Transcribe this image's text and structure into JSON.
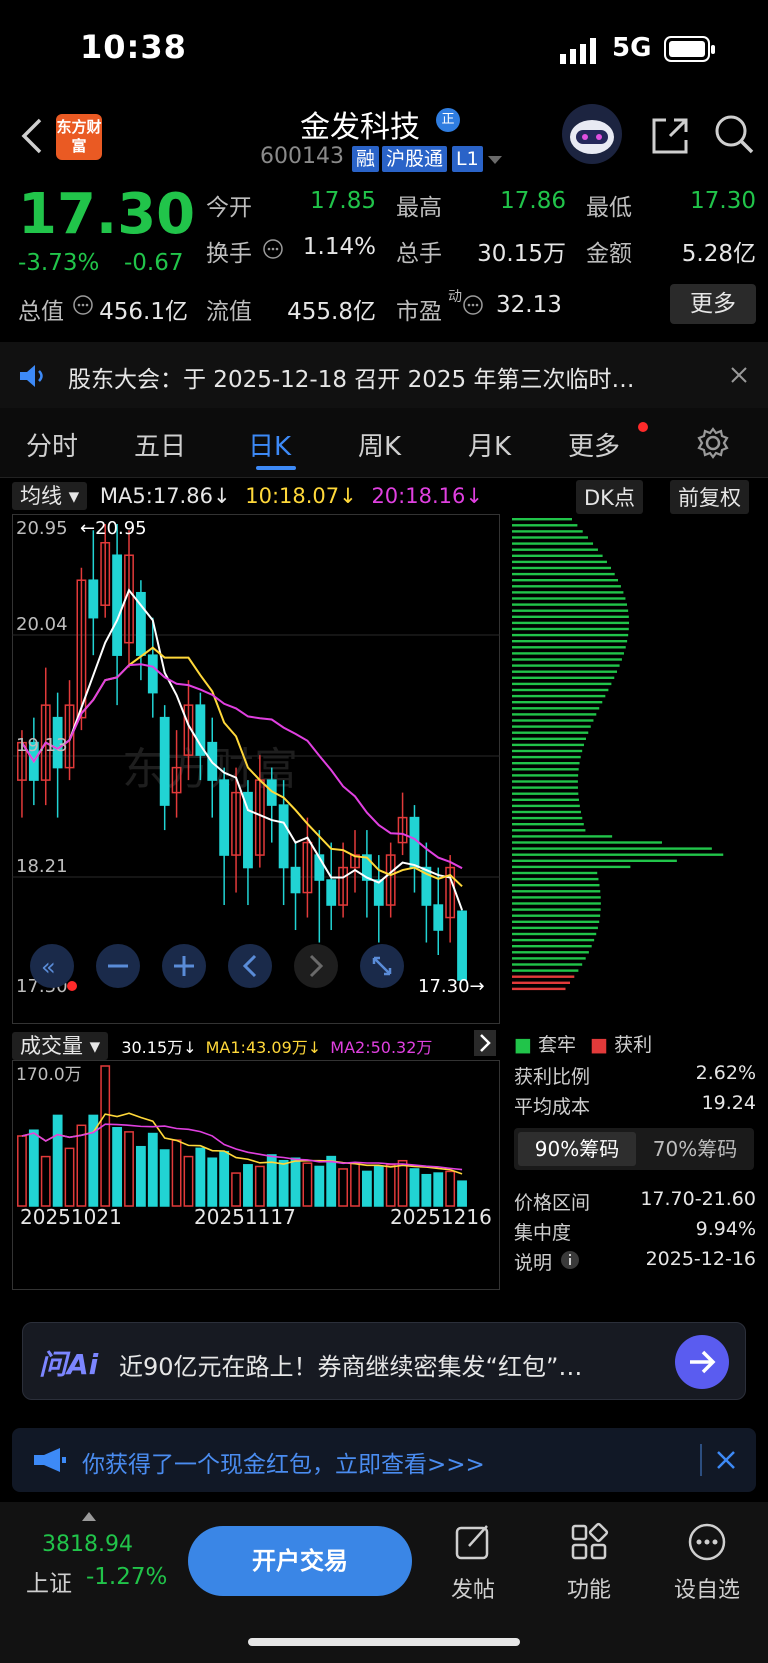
{
  "status": {
    "time": "10:38",
    "network": "5G"
  },
  "header": {
    "app_logo": "东方财富",
    "stock_name": "金发科技",
    "stock_code": "600143",
    "tags": [
      "融",
      "沪股通",
      "L1"
    ],
    "name_badge": "正"
  },
  "quote": {
    "price": "17.30",
    "change_pct": "-3.73%",
    "change_val": "-0.67",
    "fields": [
      {
        "label": "今开",
        "value": "17.85",
        "color": "#21c44a"
      },
      {
        "label": "最高",
        "value": "17.86",
        "color": "#21c44a"
      },
      {
        "label": "最低",
        "value": "17.30",
        "color": "#21c44a"
      },
      {
        "label": "换手",
        "value": "1.14%",
        "color": "#e6e6e6"
      },
      {
        "label": "总手",
        "value": "30.15万",
        "color": "#e6e6e6"
      },
      {
        "label": "金额",
        "value": "5.28亿",
        "color": "#e6e6e6"
      },
      {
        "label": "总值",
        "value": "456.1亿",
        "color": "#e6e6e6"
      },
      {
        "label": "流值",
        "value": "455.8亿",
        "color": "#e6e6e6"
      },
      {
        "label": "市盈",
        "value": "32.13",
        "color": "#e6e6e6"
      }
    ],
    "pe_superscript": "动",
    "more_label": "更多"
  },
  "notice": {
    "text": "股东大会：于 2025-12-18 召开 2025 年第三次临时…"
  },
  "tabs": [
    "分时",
    "五日",
    "日K",
    "周K",
    "月K",
    "更多"
  ],
  "active_tab": "日K",
  "chart": {
    "indicator_select": "均线",
    "ma5": "MA5:17.86↓",
    "ma10": "10:18.07↓",
    "ma20": "20:18.16↓",
    "dk_label": "DK点",
    "adjust_label": "前复权",
    "price_ticks": [
      "20.95",
      "20.04",
      "19.13",
      "18.21",
      "17.30"
    ],
    "high_marker": "←20.95",
    "last_marker": "17.30→",
    "watermark": "东方财富",
    "volume_select": "成交量",
    "vol_total": "30.15万↓",
    "vol_ma1": "MA1:43.09万↓",
    "vol_ma2": "MA2:50.32万",
    "vol_max": "170.0万",
    "dates": [
      "20251021",
      "20251117",
      "20251216"
    ]
  },
  "chip": {
    "legend_loss": "套牢",
    "legend_profit": "获利",
    "rows": [
      {
        "label": "获利比例",
        "value": "2.62%"
      },
      {
        "label": "平均成本",
        "value": "19.24"
      }
    ],
    "toggle_90": "90%筹码",
    "toggle_70": "70%筹码",
    "rows2": [
      {
        "label": "价格区间",
        "value": "17.70-21.60"
      },
      {
        "label": "集中度",
        "value": "9.94%"
      },
      {
        "label": "说明",
        "value": "2025-12-16"
      }
    ]
  },
  "chart_data": {
    "type": "candlestick",
    "ylim": [
      17.3,
      20.95
    ],
    "up_color": "#e23a3a",
    "down_color": "#21d4d4",
    "candles": [
      [
        18.9,
        19.2,
        18.6,
        19.3
      ],
      [
        19.2,
        18.9,
        18.7,
        19.4
      ],
      [
        18.9,
        19.5,
        18.7,
        19.8
      ],
      [
        19.4,
        19.0,
        18.6,
        19.6
      ],
      [
        19.0,
        19.5,
        18.9,
        19.7
      ],
      [
        19.4,
        20.5,
        19.3,
        20.6
      ],
      [
        20.5,
        20.2,
        19.9,
        20.9
      ],
      [
        20.3,
        20.8,
        20.2,
        20.95
      ],
      [
        20.7,
        19.9,
        19.5,
        20.95
      ],
      [
        20.0,
        20.7,
        19.8,
        20.9
      ],
      [
        20.4,
        19.9,
        19.7,
        20.5
      ],
      [
        19.9,
        19.6,
        19.4,
        20.2
      ],
      [
        19.4,
        18.7,
        18.5,
        19.5
      ],
      [
        18.8,
        19.0,
        18.6,
        19.3
      ],
      [
        19.1,
        19.5,
        18.9,
        19.7
      ],
      [
        19.5,
        19.1,
        18.9,
        19.6
      ],
      [
        19.2,
        18.9,
        18.6,
        19.4
      ],
      [
        18.9,
        18.3,
        17.9,
        19.0
      ],
      [
        18.3,
        18.8,
        18.0,
        19.0
      ],
      [
        18.8,
        18.2,
        17.9,
        18.9
      ],
      [
        18.3,
        18.9,
        18.2,
        19.1
      ],
      [
        18.9,
        18.7,
        18.4,
        19.0
      ],
      [
        18.7,
        18.2,
        17.9,
        18.9
      ],
      [
        18.2,
        18.0,
        17.7,
        18.4
      ],
      [
        18.0,
        18.4,
        17.8,
        18.6
      ],
      [
        18.3,
        18.1,
        17.6,
        18.5
      ],
      [
        18.1,
        17.9,
        17.7,
        18.4
      ],
      [
        17.9,
        18.2,
        17.8,
        18.4
      ],
      [
        18.2,
        18.3,
        18.0,
        18.5
      ],
      [
        18.3,
        18.1,
        17.8,
        18.5
      ],
      [
        18.1,
        17.9,
        17.6,
        18.3
      ],
      [
        17.9,
        18.3,
        17.8,
        18.4
      ],
      [
        18.4,
        18.6,
        18.3,
        18.8
      ],
      [
        18.6,
        18.2,
        18.0,
        18.7
      ],
      [
        18.2,
        17.9,
        17.6,
        18.4
      ],
      [
        17.9,
        17.7,
        17.5,
        18.2
      ],
      [
        17.8,
        18.2,
        17.6,
        18.3
      ],
      [
        17.85,
        17.3,
        17.3,
        17.86
      ]
    ],
    "volumes": [
      85,
      92,
      60,
      110,
      70,
      98,
      110,
      170,
      95,
      90,
      72,
      88,
      68,
      80,
      60,
      70,
      58,
      66,
      40,
      50,
      48,
      62,
      55,
      58,
      52,
      48,
      60,
      45,
      52,
      42,
      48,
      50,
      55,
      45,
      38,
      40,
      42,
      30.15
    ]
  }
}
